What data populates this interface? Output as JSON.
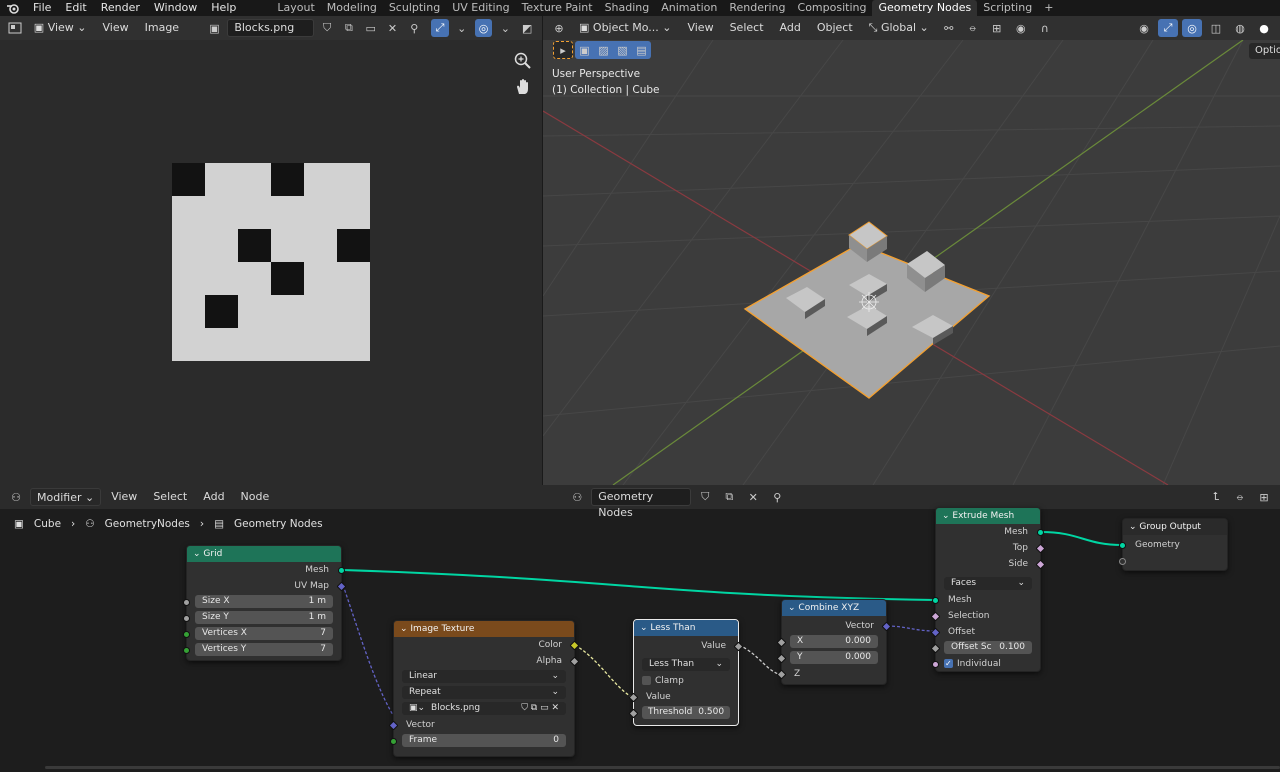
{
  "topbar": {
    "menus": [
      "File",
      "Edit",
      "Render",
      "Window",
      "Help"
    ],
    "workspaces": [
      "Layout",
      "Modeling",
      "Sculpting",
      "UV Editing",
      "Texture Paint",
      "Shading",
      "Animation",
      "Rendering",
      "Compositing",
      "Geometry Nodes",
      "Scripting"
    ],
    "active_workspace": "Geometry Nodes"
  },
  "image_editor": {
    "view_mode": "View",
    "menus": [
      "View",
      "Image"
    ],
    "image_name": "Blocks.png",
    "texture_grid": [
      [
        1,
        0,
        0,
        1,
        0,
        0
      ],
      [
        0,
        0,
        0,
        0,
        0,
        0
      ],
      [
        0,
        0,
        1,
        0,
        0,
        1
      ],
      [
        0,
        0,
        0,
        1,
        0,
        0
      ],
      [
        0,
        1,
        0,
        0,
        0,
        0
      ],
      [
        0,
        0,
        0,
        0,
        0,
        0
      ]
    ]
  },
  "viewport": {
    "mode": "Object Mo...",
    "menus": [
      "View",
      "Select",
      "Add",
      "Object"
    ],
    "transform": "Global",
    "perspective_label": "User Perspective",
    "collection_label": "(1) Collection | Cube",
    "options_label": "Optio"
  },
  "node_editor": {
    "editor_type": "Modifier",
    "menus": [
      "View",
      "Select",
      "Add",
      "Node"
    ],
    "node_group": "Geometry Nodes",
    "breadcrumb": [
      "Cube",
      "GeometryNodes",
      "Geometry Nodes"
    ],
    "nodes": {
      "grid": {
        "title": "Grid",
        "outputs": [
          "Mesh",
          "UV Map"
        ],
        "fields": [
          {
            "label": "Size X",
            "value": "1 m"
          },
          {
            "label": "Size Y",
            "value": "1 m"
          },
          {
            "label": "Vertices X",
            "value": "7"
          },
          {
            "label": "Vertices Y",
            "value": "7"
          }
        ]
      },
      "image_texture": {
        "title": "Image Texture",
        "outputs": [
          "Color",
          "Alpha"
        ],
        "interpolation": "Linear",
        "extension": "Repeat",
        "image": "Blocks.png",
        "inputs": [
          "Vector"
        ],
        "frame_label": "Frame",
        "frame_value": "0"
      },
      "less_than": {
        "title": "Less Than",
        "output": "Value",
        "operation": "Less Than",
        "clamp_label": "Clamp",
        "input": "Value",
        "threshold_label": "Threshold",
        "threshold_value": "0.500"
      },
      "combine_xyz": {
        "title": "Combine XYZ",
        "output": "Vector",
        "x_label": "X",
        "x_value": "0.000",
        "y_label": "Y",
        "y_value": "0.000",
        "z_label": "Z"
      },
      "extrude_mesh": {
        "title": "Extrude Mesh",
        "outputs": [
          "Mesh",
          "Top",
          "Side"
        ],
        "mode": "Faces",
        "inputs": [
          "Mesh",
          "Selection",
          "Offset"
        ],
        "offset_scale_label": "Offset Sc",
        "offset_scale_value": "0.100",
        "individual_label": "Individual"
      },
      "group_output": {
        "title": "Group Output",
        "inputs": [
          "Geometry"
        ]
      }
    },
    "colors": {
      "geometry_header": "#1e7458",
      "texture_header": "#7a4a1c",
      "converter_header": "#2a5a87",
      "geometry_socket": "#00d6a3",
      "vector_socket": "#6363c7",
      "color_socket": "#c7c729",
      "float_socket": "#a1a1a1",
      "int_socket": "#35a135",
      "bool_socket": "#cca6d6"
    }
  }
}
